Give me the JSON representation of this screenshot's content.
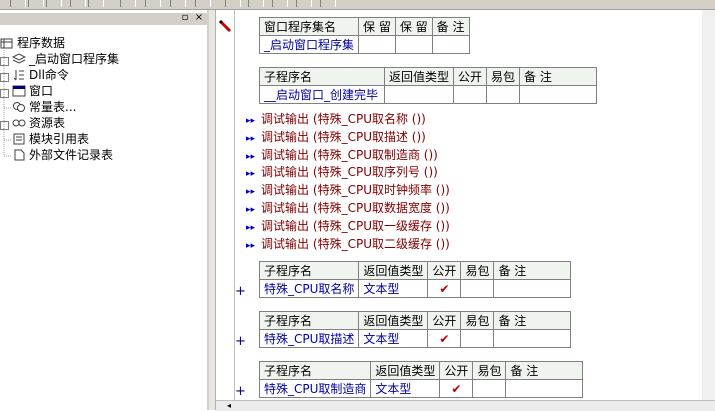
{
  "tree": {
    "root_label": "程序数据",
    "items": [
      {
        "label": "_启动窗口程序集",
        "icon": "layers-icon"
      },
      {
        "label": "Dll命令",
        "icon": "dll-command-icon"
      },
      {
        "label": "窗口",
        "icon": "window-icon"
      },
      {
        "label": "常量表...",
        "icon": "constants-icon"
      },
      {
        "label": "资源表",
        "icon": "resource-icon"
      },
      {
        "label": "模块引用表",
        "icon": "module-ref-icon"
      },
      {
        "label": "外部文件记录表",
        "icon": "external-file-icon"
      }
    ]
  },
  "assembly_table": {
    "headers": [
      "窗口程序集名",
      "保 留",
      "保 留",
      "备 注"
    ],
    "row": [
      "_启动窗口程序集",
      "",
      "",
      ""
    ]
  },
  "sub_table_main": {
    "headers": [
      "子程序名",
      "返回值类型",
      "公开",
      "易包",
      "备 注"
    ],
    "row": [
      "__启动窗口_创建完毕",
      "",
      "",
      "",
      ""
    ]
  },
  "debug_lines": [
    {
      "cmd": "调试输出",
      "arg": "(特殊_CPU取名称 ())"
    },
    {
      "cmd": "调试输出",
      "arg": "(特殊_CPU取描述 ())"
    },
    {
      "cmd": "调试输出",
      "arg": "(特殊_CPU取制造商 ())"
    },
    {
      "cmd": "调试输出",
      "arg": "(特殊_CPU取序列号 ())"
    },
    {
      "cmd": "调试输出",
      "arg": "(特殊_CPU取时钟频率 ())"
    },
    {
      "cmd": "调试输出",
      "arg": "(特殊_CPU取数据宽度 ())"
    },
    {
      "cmd": "调试输出",
      "arg": "(特殊_CPU取一级缓存 ())"
    },
    {
      "cmd": "调试输出",
      "arg": "(特殊_CPU取二级缓存 ())"
    }
  ],
  "sub_tables": [
    {
      "headers": [
        "子程序名",
        "返回值类型",
        "公开",
        "易包",
        "备 注"
      ],
      "name": "特殊_CPU取名称",
      "type": "文本型",
      "public": "✔"
    },
    {
      "headers": [
        "子程序名",
        "返回值类型",
        "公开",
        "易包",
        "备 注"
      ],
      "name": "特殊_CPU取描述",
      "type": "文本型",
      "public": "✔"
    },
    {
      "headers": [
        "子程序名",
        "返回值类型",
        "公开",
        "易包",
        "备 注"
      ],
      "name": "特殊_CPU取制造商",
      "type": "文本型",
      "public": "✔"
    }
  ],
  "glyphs": {
    "plus": "+",
    "arrow": "▸▸",
    "pin": "▫",
    "close": "×"
  }
}
